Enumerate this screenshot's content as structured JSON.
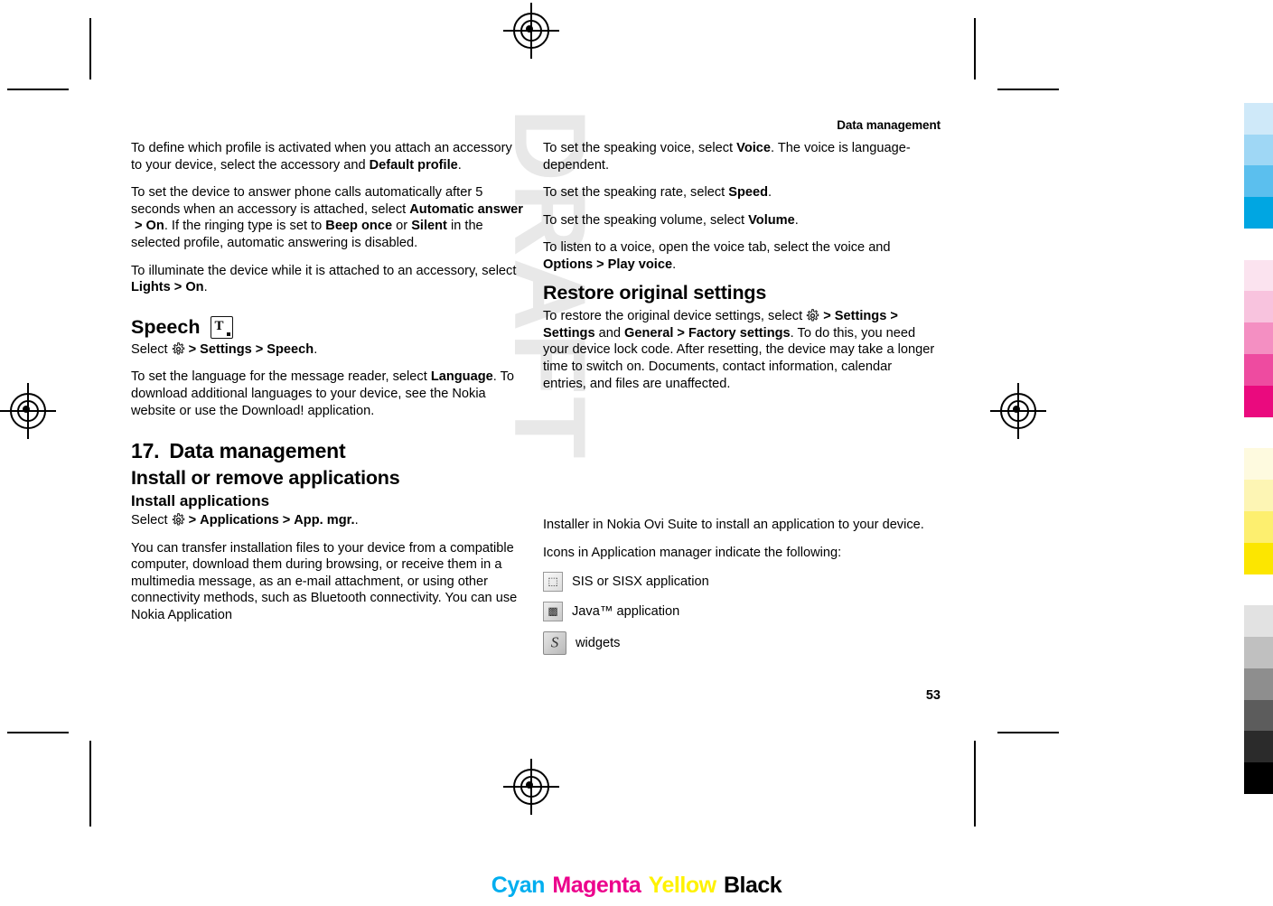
{
  "header": {
    "running_title": "Data management"
  },
  "page_number": "53",
  "watermark": "DRAFT",
  "left_column": {
    "p1_a": "To define which profile is activated when you attach an accessory to your device, select the accessory and ",
    "p1_b": "Default profile",
    "p1_c": ".",
    "p2_a": "To set the device to answer phone calls automatically after 5 seconds when an accessory is attached, select ",
    "p2_b": "Automatic answer",
    "p2_arrow": ">",
    "p2_c": "On",
    "p2_d": ". If the ringing type is set to ",
    "p2_e": "Beep once",
    "p2_f": " or ",
    "p2_g": "Silent",
    "p2_h": " in the selected profile, automatic answering is disabled.",
    "p3_a": "To illuminate the device while it is attached to an accessory, select ",
    "p3_b": "Lights",
    "p3_arrow": ">",
    "p3_c": "On",
    "p3_d": ".",
    "speech_heading": "Speech",
    "speech_select_a": "Select ",
    "speech_gear": "gear-icon",
    "speech_arrow1": ">",
    "speech_settings": "Settings",
    "speech_arrow2": ">",
    "speech_speech": "Speech",
    "speech_dot": ".",
    "p4_a": "To set the language for the message reader, select ",
    "p4_b": "Language",
    "p4_c": ". To download additional languages to your device, see the Nokia website or use the Download! application.",
    "chapter_number": "17.",
    "chapter_title": "Data management",
    "h_install_remove": "Install or remove applications",
    "h_install_apps": "Install applications",
    "select_line_a": "Select ",
    "select_arrow1": ">",
    "select_applications": "Applications",
    "select_arrow2": ">",
    "select_appmgr": "App. mgr.",
    "select_dot": ".",
    "p5": "You can transfer installation files to your device from a compatible computer, download them during browsing, or receive them in a multimedia message, as an e-mail attachment, or using other connectivity methods, such as Bluetooth connectivity. You can use Nokia Application"
  },
  "right_column": {
    "p1_a": "To set the speaking voice, select ",
    "p1_b": "Voice",
    "p1_c": ". The voice is language-dependent.",
    "p2_a": "To set the speaking rate, select ",
    "p2_b": "Speed",
    "p2_c": ".",
    "p3_a": "To set the speaking volume, select ",
    "p3_b": "Volume",
    "p3_c": ".",
    "p4_a": "To listen to a voice, open the voice tab, select the voice and ",
    "p4_b": "Options",
    "p4_arrow": ">",
    "p4_c": "Play voice",
    "p4_d": ".",
    "h_restore": "Restore original settings",
    "p5_a": "To restore the original device settings, select ",
    "p5_gear": "gear-icon",
    "p5_arrow1": ">",
    "p5_b": "Settings",
    "p5_arrow2": ">",
    "p5_c": "Settings",
    "p5_d": " and ",
    "p5_e": "General",
    "p5_arrow3": ">",
    "p5_f": "Factory settings",
    "p5_g": ". To do this, you need your device lock code. After resetting, the device may take a longer time to switch on. Documents, contact information, calendar entries, and files are unaffected.",
    "p6": "Installer in Nokia Ovi Suite to install an application to your device.",
    "p7": "Icons in Application manager indicate the following:",
    "icon1_name": "sis-sisx-application-icon",
    "icon1_label": "SIS or SISX application",
    "icon2_name": "java-application-icon",
    "icon2_label": "Java™ application",
    "icon3_name": "widgets-icon",
    "icon3_label": "widgets"
  },
  "color_words": [
    "Cyan",
    "Magenta",
    "Yellow",
    "Black"
  ],
  "color_bars": [
    "#ffffff",
    "#cfe9f9",
    "#9fd7f5",
    "#5bbfee",
    "#00a6e2",
    "#ffffff",
    "#fbe3ef",
    "#f8c3de",
    "#f48fc2",
    "#ee4ba0",
    "#ea0a7e",
    "#ffffff",
    "#fefadf",
    "#fdf5b4",
    "#fdef6f",
    "#fce600",
    "#ffffff",
    "#e2e2e2",
    "#c0c0c0",
    "#8e8e8e",
    "#5c5c5c",
    "#2b2b2b",
    "#000000"
  ]
}
